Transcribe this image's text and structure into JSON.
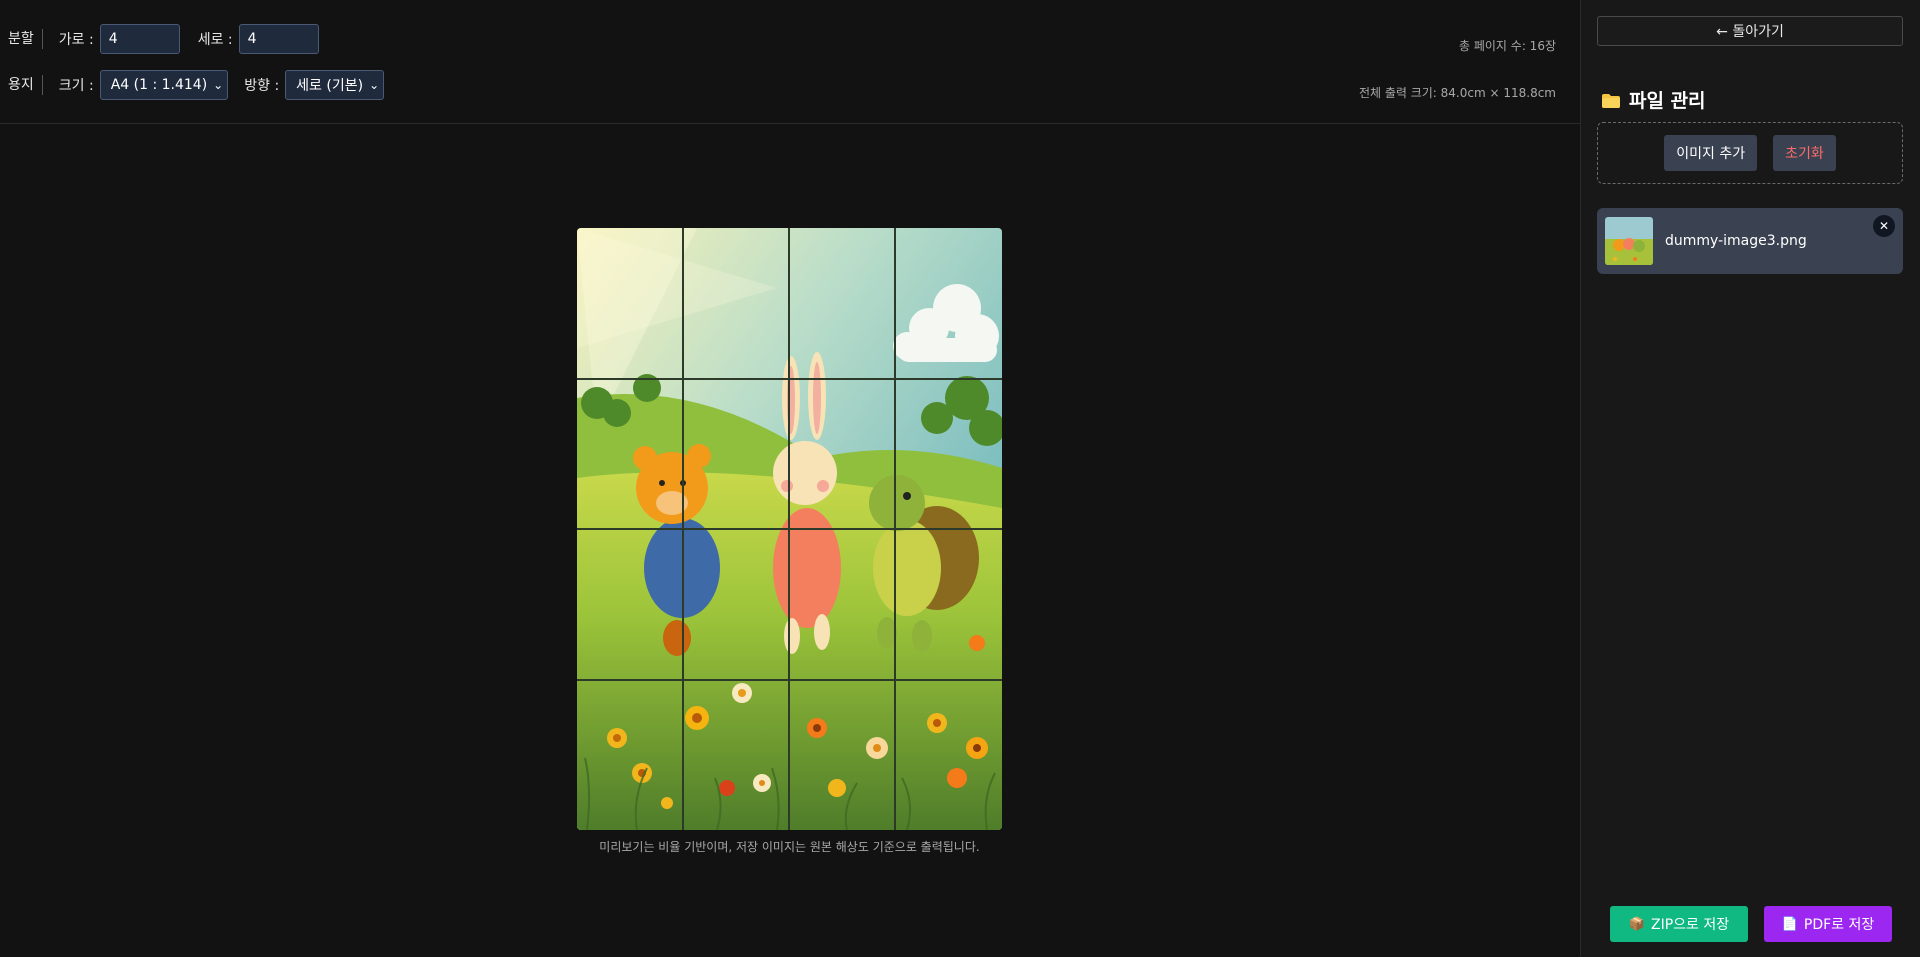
{
  "toolbar": {
    "split_label": "분할",
    "horizontal_label": "가로 :",
    "horizontal_value": "4",
    "vertical_label": "세로 :",
    "vertical_value": "4",
    "paper_label": "용지",
    "size_label": "크기 :",
    "size_selected": "A4 (1 : 1.414)",
    "orientation_label": "방향 :",
    "orientation_selected": "세로 (기본)",
    "total_pages": "총 페이지 수: 16장",
    "total_size": "전체 출력 크기: 84.0cm × 118.8cm"
  },
  "preview": {
    "caption": "미리보기는 비율 기반이며, 저장 이미지는 원본 해상도 기준으로 출력됩니다.",
    "columns": 4,
    "rows": 4
  },
  "sidebar": {
    "back_label": "← 돌아가기",
    "section_title": "파일 관리",
    "add_image_label": "이미지 추가",
    "reset_label": "초기화",
    "files": [
      {
        "name": "dummy-image3.png"
      }
    ],
    "zip_label": "ZIP으로 저장",
    "pdf_label": "PDF로 저장"
  },
  "colors": {
    "zip": "#10b981",
    "pdf": "#9b27f0",
    "reset_text": "#ff6b6b",
    "input_bg": "#1f2a3d"
  },
  "icons": {
    "folder": "folder-icon",
    "close": "close-icon",
    "zip": "package-icon",
    "pdf": "document-icon"
  }
}
